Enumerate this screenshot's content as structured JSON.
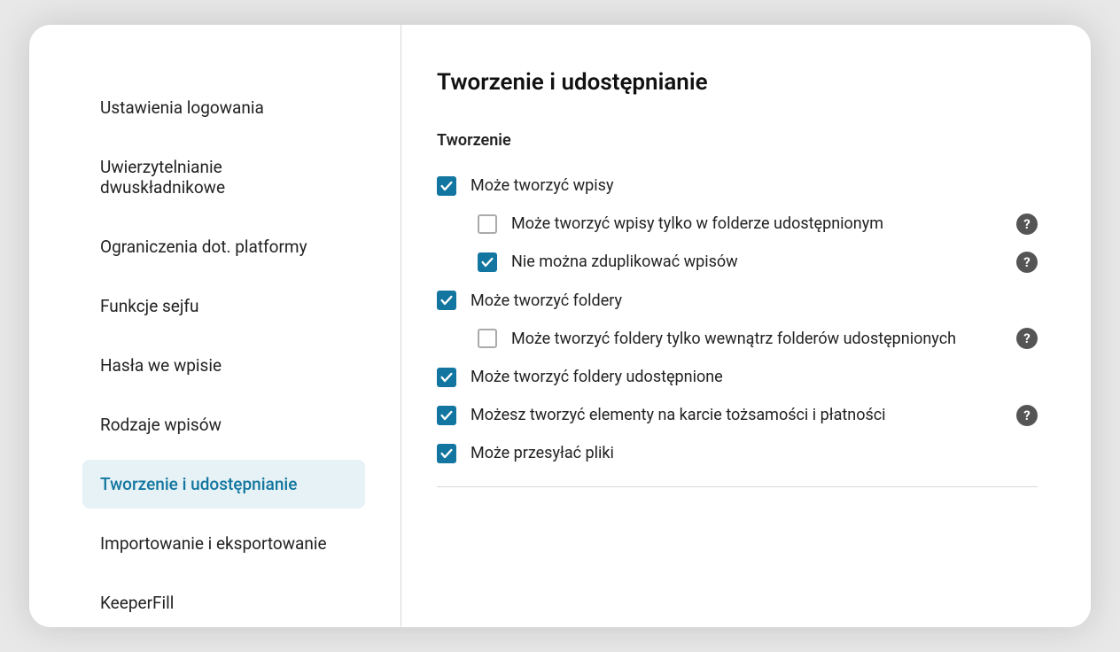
{
  "sidebar": {
    "items": [
      {
        "label": "Ustawienia logowania",
        "active": false
      },
      {
        "label": "Uwierzytelnianie dwuskładnikowe",
        "active": false
      },
      {
        "label": "Ograniczenia dot. platformy",
        "active": false
      },
      {
        "label": "Funkcje sejfu",
        "active": false
      },
      {
        "label": "Hasła we wpisie",
        "active": false
      },
      {
        "label": "Rodzaje wpisów",
        "active": false
      },
      {
        "label": "Tworzenie i udostępnianie",
        "active": true
      },
      {
        "label": "Importowanie i eksportowanie",
        "active": false
      },
      {
        "label": "KeeperFill",
        "active": false
      }
    ]
  },
  "main": {
    "title": "Tworzenie i udostępnianie",
    "section_title": "Tworzenie",
    "options": [
      {
        "label": "Może tworzyć wpisy",
        "checked": true,
        "indent": 0,
        "help": false
      },
      {
        "label": "Może tworzyć wpisy tylko w folderze udostępnionym",
        "checked": false,
        "indent": 1,
        "help": true
      },
      {
        "label": "Nie można zduplikować wpisów",
        "checked": true,
        "indent": 1,
        "help": true
      },
      {
        "label": "Może tworzyć foldery",
        "checked": true,
        "indent": 0,
        "help": false
      },
      {
        "label": "Może tworzyć foldery tylko wewnątrz folderów udostępnionych",
        "checked": false,
        "indent": 1,
        "help": true
      },
      {
        "label": "Może tworzyć foldery udostępnione",
        "checked": true,
        "indent": 0,
        "help": false
      },
      {
        "label": "Możesz tworzyć elementy na karcie tożsamości i płatności",
        "checked": true,
        "indent": 0,
        "help": true
      },
      {
        "label": "Może przesyłać pliki",
        "checked": true,
        "indent": 0,
        "help": false
      }
    ]
  }
}
